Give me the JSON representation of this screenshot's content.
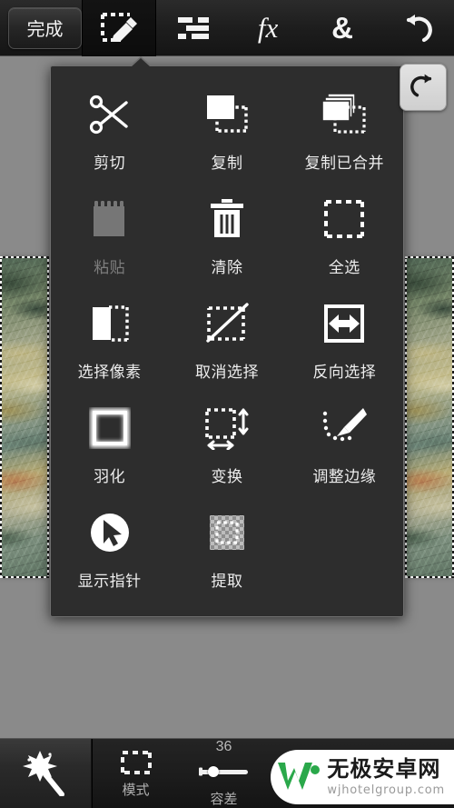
{
  "top_toolbar": {
    "done_label": "完成",
    "tools": [
      {
        "name": "selection-edit-tool",
        "icon": "marquee-pencil-icon",
        "active": true
      },
      {
        "name": "adjustments-tool",
        "icon": "sliders-icon",
        "active": false
      },
      {
        "name": "effects-tool",
        "icon": "fx-icon",
        "glyph": "fx",
        "active": false
      },
      {
        "name": "blend-tool",
        "icon": "ampersand-icon",
        "glyph": "&",
        "active": false
      },
      {
        "name": "undo-tool",
        "icon": "undo-arrow-icon",
        "active": false
      }
    ]
  },
  "redo_button": {
    "icon": "redo-arrow-icon",
    "label": ""
  },
  "menu_panel": {
    "items": [
      {
        "label": "剪切",
        "icon": "scissors-icon",
        "disabled": false
      },
      {
        "label": "复制",
        "icon": "copy-icon",
        "disabled": false
      },
      {
        "label": "复制已合并",
        "icon": "copy-merged-icon",
        "disabled": false
      },
      {
        "label": "粘贴",
        "icon": "paste-icon",
        "disabled": true
      },
      {
        "label": "清除",
        "icon": "trash-icon",
        "disabled": false
      },
      {
        "label": "全选",
        "icon": "select-all-icon",
        "disabled": false
      },
      {
        "label": "选择像素",
        "icon": "select-pixels-icon",
        "disabled": false
      },
      {
        "label": "取消选择",
        "icon": "deselect-icon",
        "disabled": false
      },
      {
        "label": "反向选择",
        "icon": "invert-selection-icon",
        "disabled": false
      },
      {
        "label": "羽化",
        "icon": "feather-icon",
        "disabled": false
      },
      {
        "label": "变换",
        "icon": "transform-icon",
        "disabled": false
      },
      {
        "label": "调整边缘",
        "icon": "refine-edge-icon",
        "disabled": false
      },
      {
        "label": "显示指针",
        "icon": "show-pointer-icon",
        "disabled": false
      },
      {
        "label": "提取",
        "icon": "extract-icon",
        "disabled": false
      }
    ]
  },
  "bottom_toolbar": {
    "active_tool_icon": "magic-wand-icon",
    "options": [
      {
        "label": "模式",
        "value": "",
        "icon": "marquee-dashed-icon",
        "type": "icon"
      },
      {
        "label": "容差",
        "value": "36",
        "icon": "slider-icon",
        "type": "slider"
      }
    ]
  },
  "watermark": {
    "logo": "w-logo-icon",
    "title": "无极安卓网",
    "subtitle": "wjhotelgroup.com",
    "brand_color": "#2aa84a"
  },
  "canvas": {
    "selection_active": true,
    "background_color": "#8a8a8a"
  }
}
